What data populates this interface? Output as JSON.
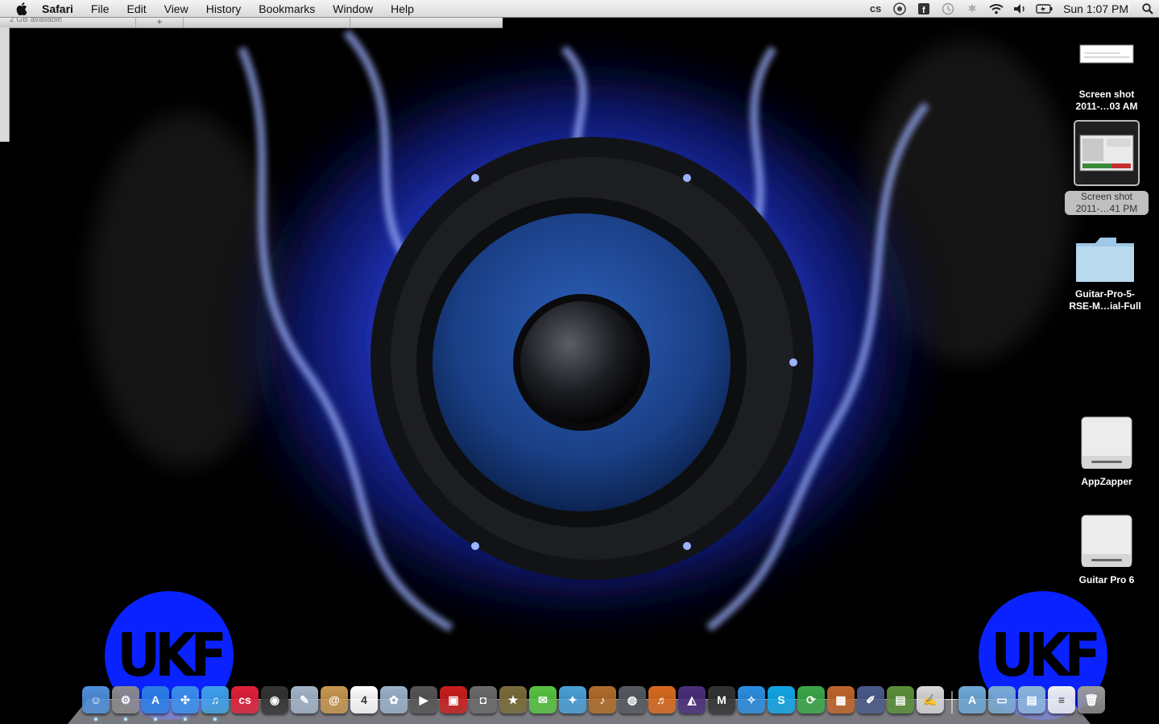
{
  "menubar": {
    "apple_icon": "apple-logo-icon",
    "app_name": "Safari",
    "menus": [
      "File",
      "Edit",
      "View",
      "History",
      "Bookmarks",
      "Window",
      "Help"
    ],
    "status_icons": [
      "cs-icon",
      "sync-icon",
      "facebook-icon",
      "time-machine-icon",
      "bluetooth-icon",
      "wifi-icon",
      "volume-icon",
      "battery-icon"
    ],
    "clock": "Sun 1:07 PM",
    "spotlight_icon": "spotlight-search-icon"
  },
  "background_window": {
    "status_text": "2 GB available",
    "add_button": "+"
  },
  "desktop": {
    "icons": [
      {
        "line1": "Screen shot",
        "line2": "2011-…03 AM",
        "kind": "screenshot-file-icon",
        "selected": false
      },
      {
        "line1": "Screen shot",
        "line2": "2011-…41 PM",
        "kind": "screenshot-file-icon",
        "selected": true
      },
      {
        "line1": "Guitar-Pro-5-",
        "line2": "RSE-M…ial-Full",
        "kind": "folder-icon",
        "selected": false
      },
      {
        "line1": "AppZapper",
        "line2": "",
        "kind": "disk-image-icon",
        "selected": false
      },
      {
        "line1": "Guitar Pro 6",
        "line2": "",
        "kind": "disk-image-icon",
        "selected": false
      }
    ]
  },
  "wallpaper": {
    "logo_text": "UKF",
    "flame_color": "#3a5bff",
    "logo_color": "#0a22ff"
  },
  "dock": {
    "apps": [
      {
        "name": "finder-icon",
        "glyph": "☺",
        "color": "#4f8fdc",
        "running": true
      },
      {
        "name": "system-preferences-icon",
        "glyph": "⚙",
        "color": "#8a8a8a",
        "running": true
      },
      {
        "name": "app-store-icon",
        "glyph": "A",
        "color": "#2a7de1",
        "running": true
      },
      {
        "name": "safari-icon",
        "glyph": "✣",
        "color": "#3a8ee6",
        "running": true
      },
      {
        "name": "itunes-icon",
        "glyph": "♫",
        "color": "#3fa0e8",
        "running": true
      },
      {
        "name": "lastfm-icon",
        "glyph": "cs",
        "color": "#e0203a",
        "running": false
      },
      {
        "name": "dashboard-icon",
        "glyph": "◉",
        "color": "#333333",
        "running": false
      },
      {
        "name": "preview-icon",
        "glyph": "✎",
        "color": "#a2b4c8",
        "running": false
      },
      {
        "name": "address-book-icon",
        "glyph": "@",
        "color": "#c8964f",
        "running": false
      },
      {
        "name": "ical-icon",
        "glyph": "4",
        "color": "#ffffff",
        "running": false
      },
      {
        "name": "iphoto-icon",
        "glyph": "✿",
        "color": "#9ab1c9",
        "running": false
      },
      {
        "name": "facetime-icon",
        "glyph": "▶",
        "color": "#555555",
        "running": false
      },
      {
        "name": "photo-booth-icon",
        "glyph": "▣",
        "color": "#c81e1e",
        "running": false
      },
      {
        "name": "image-capture-icon",
        "glyph": "◘",
        "color": "#6a6a6a",
        "running": false
      },
      {
        "name": "widget-icon",
        "glyph": "★",
        "color": "#7a6b3a",
        "running": false
      },
      {
        "name": "messages-icon",
        "glyph": "✉",
        "color": "#58c342",
        "running": false
      },
      {
        "name": "notes-icon",
        "glyph": "✦",
        "color": "#4aa0d8",
        "running": false
      },
      {
        "name": "guitar-pro-icon",
        "glyph": "♪",
        "color": "#b06d2a",
        "running": false
      },
      {
        "name": "disk-utility-icon",
        "glyph": "◍",
        "color": "#555a60",
        "running": false
      },
      {
        "name": "garageband-icon",
        "glyph": "♬",
        "color": "#d86a1f",
        "running": false
      },
      {
        "name": "pro-tools-icon",
        "glyph": "◭",
        "color": "#4a2e7a",
        "running": false
      },
      {
        "name": "mbox-icon",
        "glyph": "M",
        "color": "#333333",
        "running": false
      },
      {
        "name": "twitter-icon",
        "glyph": "✧",
        "color": "#2b8ee0",
        "running": false
      },
      {
        "name": "skype-icon",
        "glyph": "S",
        "color": "#12a7e6",
        "running": false
      },
      {
        "name": "bittorrent-icon",
        "glyph": "⟳",
        "color": "#3ba84a",
        "running": false
      },
      {
        "name": "keynote-icon",
        "glyph": "▦",
        "color": "#c0652a",
        "running": false
      },
      {
        "name": "script-editor-icon",
        "glyph": "✐",
        "color": "#4a5a8a",
        "running": false
      },
      {
        "name": "numbers-icon",
        "glyph": "▤",
        "color": "#5a8f3a",
        "running": false
      },
      {
        "name": "textedit-icon",
        "glyph": "✍",
        "color": "#d8d8d8",
        "running": false
      }
    ],
    "stacks": [
      {
        "name": "applications-stack-icon",
        "glyph": "A",
        "color": "#6fa8d8"
      },
      {
        "name": "documents-stack-icon",
        "glyph": "▭",
        "color": "#7aaad4"
      },
      {
        "name": "downloads-stack-icon",
        "glyph": "▤",
        "color": "#8ab4d8"
      },
      {
        "name": "document-file-icon",
        "glyph": "≡",
        "color": "#f0f0f0"
      },
      {
        "name": "trash-icon",
        "glyph": "🗑",
        "color": "#9a9a9a"
      }
    ]
  }
}
